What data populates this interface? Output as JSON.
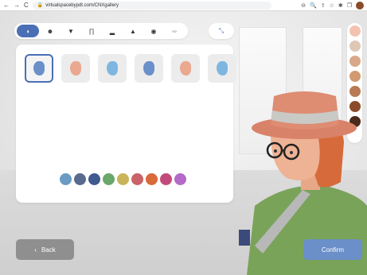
{
  "browser": {
    "back_glyph": "←",
    "forward_glyph": "→",
    "reload_glyph": "C",
    "lock_glyph": "🔒",
    "url": "virtualspacebypdt.com/CNXgallery",
    "icons": [
      "search-icon",
      "share-icon",
      "star-icon",
      "extensions-icon",
      "window-icon",
      "profile-icon"
    ],
    "icon_glyphs": {
      "zoom": "⊖",
      "search": "🔍",
      "share": "⇪",
      "star": "☆",
      "ext": "✱",
      "win": "❐"
    }
  },
  "toolbar": {
    "categories": [
      {
        "name": "ear",
        "glyph": "◖",
        "active": true
      },
      {
        "name": "face",
        "glyph": "☻",
        "active": false
      },
      {
        "name": "shirt",
        "glyph": "▼",
        "active": false
      },
      {
        "name": "pants",
        "glyph": "∏",
        "active": false
      },
      {
        "name": "shoes",
        "glyph": "▂",
        "active": false
      },
      {
        "name": "hat",
        "glyph": "▲",
        "active": false
      },
      {
        "name": "accessory",
        "glyph": "◉",
        "active": false
      },
      {
        "name": "glasses",
        "glyph": "◦◦",
        "active": false
      }
    ],
    "zoom_glyph": "⤡"
  },
  "items": [
    {
      "name": "ear-style-1",
      "color": "#6b8fc9",
      "selected": true
    },
    {
      "name": "ear-style-2",
      "color": "#e9a88f",
      "selected": false
    },
    {
      "name": "ear-style-3",
      "color": "#7fb6e0",
      "selected": false
    },
    {
      "name": "ear-style-4",
      "color": "#6b8fc9",
      "selected": false
    },
    {
      "name": "ear-style-5",
      "color": "#e9a88f",
      "selected": false
    },
    {
      "name": "ear-style-6",
      "color": "#7fb6e0",
      "selected": false
    }
  ],
  "colors": [
    "#6a9bc3",
    "#5a6a8f",
    "#3f5a8f",
    "#6aa86a",
    "#c9b45a",
    "#c9646a",
    "#d96a3a",
    "#c24a7a",
    "#b36ac9"
  ],
  "skin_tones": [
    "#f2c4b0",
    "#dfc7b6",
    "#d9a889",
    "#d29a70",
    "#b87a52",
    "#8a4a2a",
    "#4a2a1a"
  ],
  "buttons": {
    "back_glyph": "‹",
    "back_label": "Back",
    "confirm_label": "Confirm"
  }
}
